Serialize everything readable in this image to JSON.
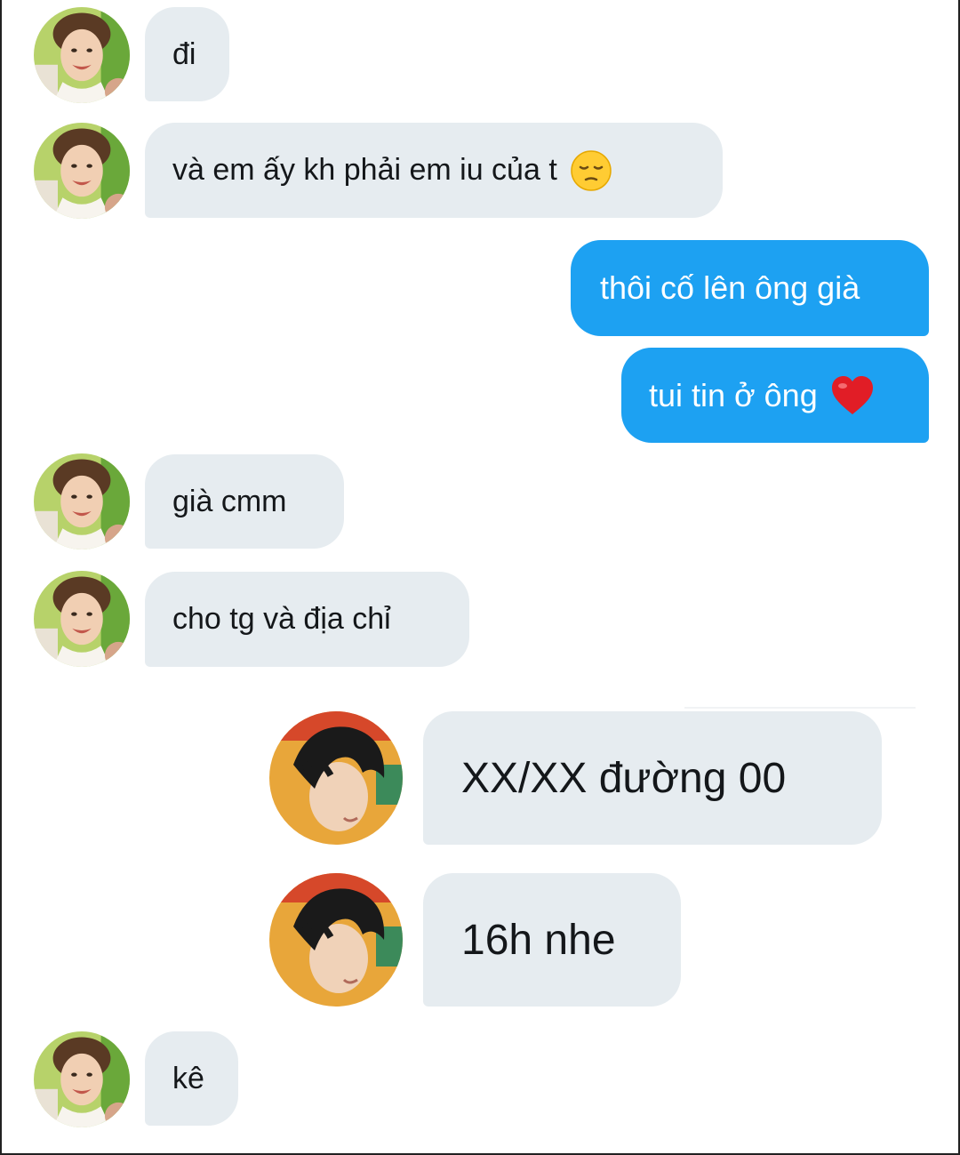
{
  "conversation": {
    "messages": [
      {
        "sender": "them",
        "text": "đi"
      },
      {
        "sender": "them",
        "text": "và em ấy kh phải em iu của t",
        "emoji": "pensive-face-emoji"
      },
      {
        "sender": "me",
        "text": "thôi cố lên ông già"
      },
      {
        "sender": "me",
        "text": "tui tin ở ông",
        "emoji": "red-heart-emoji"
      },
      {
        "sender": "them",
        "text": "già cmm"
      },
      {
        "sender": "them",
        "text": "cho tg và địa chỉ"
      },
      {
        "sender": "other",
        "text": "XX/XX đường 00"
      },
      {
        "sender": "other",
        "text": "16h nhe"
      },
      {
        "sender": "them",
        "text": "kê"
      }
    ]
  },
  "colors": {
    "incoming_bubble": "#e6ecf0",
    "outgoing_bubble": "#1da1f2",
    "outgoing_text": "#ffffff",
    "incoming_text": "#14171a"
  },
  "icons": {
    "avatar_them": "avatar-smiling-boy-icon",
    "avatar_other": "avatar-dark-hair-portrait-icon",
    "emoji_1": "pensive-face-emoji",
    "emoji_2": "red-heart-emoji"
  }
}
